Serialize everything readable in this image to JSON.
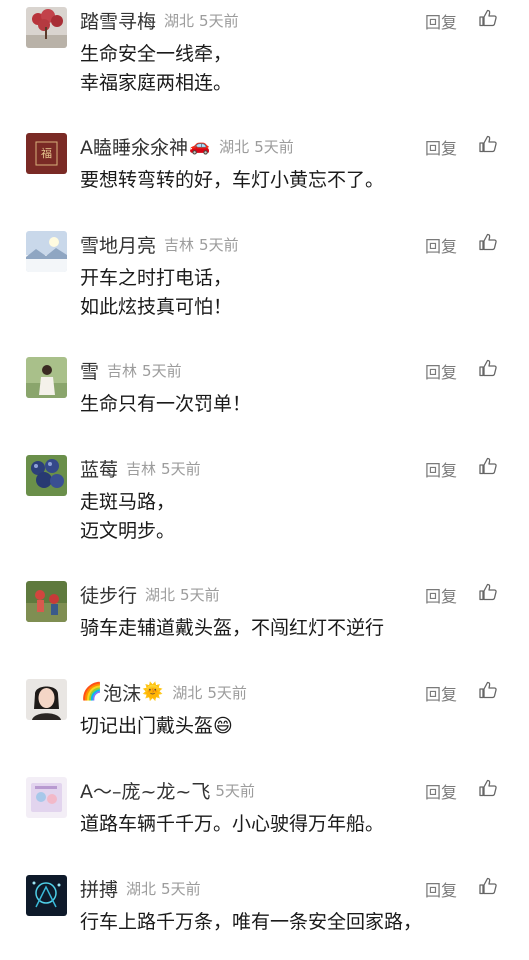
{
  "reply_label": "回复",
  "like_icon": "thumb-up-icon",
  "comments": [
    {
      "name": "踏雪寻梅",
      "emoji": "",
      "suffix_emoji": "",
      "location": "湖北",
      "time": "5天前",
      "lines": [
        "生命安全一线牵，",
        "幸福家庭两相连。"
      ]
    },
    {
      "name": "A瞌睡氽氽神",
      "emoji": "",
      "suffix_emoji": "🚗",
      "location": "湖北",
      "time": "5天前",
      "lines": [
        "要想转弯转的好，车灯小黄忘不了。"
      ]
    },
    {
      "name": "雪地月亮",
      "emoji": "",
      "suffix_emoji": "",
      "location": "吉林",
      "time": "5天前",
      "lines": [
        "开车之时打电话，",
        "如此炫技真可怕！"
      ]
    },
    {
      "name": "雪",
      "emoji": "",
      "suffix_emoji": "",
      "location": "吉林",
      "time": "5天前",
      "lines": [
        "生命只有一次罚单！"
      ]
    },
    {
      "name": "蓝莓",
      "emoji": "",
      "suffix_emoji": "",
      "location": "吉林",
      "time": "5天前",
      "lines": [
        "走斑马路，",
        "迈文明步。"
      ]
    },
    {
      "name": "徒步行",
      "emoji": "",
      "suffix_emoji": "",
      "location": "湖北",
      "time": "5天前",
      "lines": [
        "骑车走辅道戴头盔，不闯红灯不逆行"
      ]
    },
    {
      "name": "泡沫",
      "emoji": "🌈",
      "suffix_emoji": "🌞",
      "location": "湖北",
      "time": "5天前",
      "lines": [
        "切记出门戴头盔😄"
      ]
    },
    {
      "name": "A～–庞~龙~飞",
      "emoji": "",
      "suffix_emoji": "",
      "location": "",
      "time": "5天前",
      "lines": [
        "道路车辆千千万。小心驶得万年船。"
      ]
    },
    {
      "name": "拼搏",
      "emoji": "",
      "suffix_emoji": "",
      "location": "湖北",
      "time": "5天前",
      "lines": [
        "行车上路千万条，唯有一条安全回家路，"
      ]
    }
  ]
}
